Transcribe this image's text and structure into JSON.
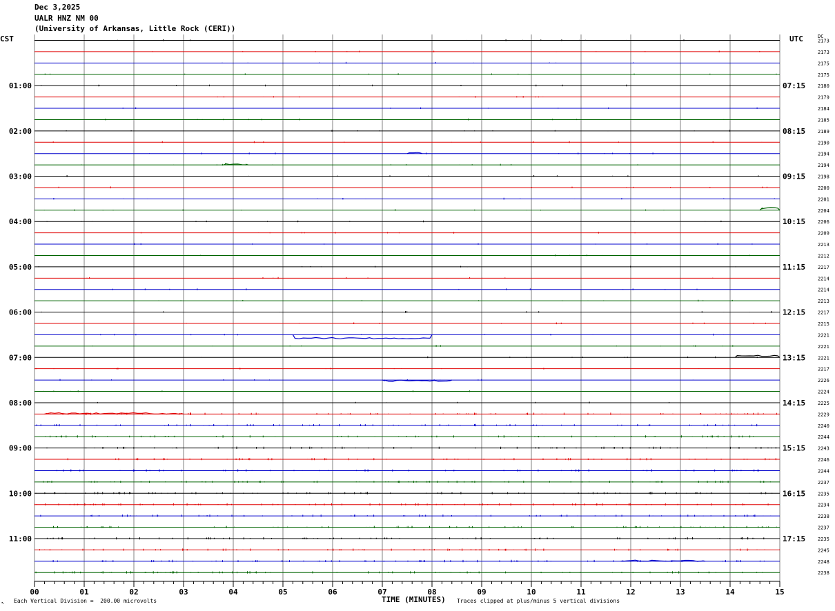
{
  "header": {
    "date": "Dec 3,2025",
    "station": "UALR HNZ NM 00",
    "network": "(University of Arkansas, Little Rock (CERI))"
  },
  "labels": {
    "left_zone": "CST",
    "right_zone": "UTC",
    "dc_label": "DC"
  },
  "footer": {
    "marker": "↖",
    "vertical_division": "Each Vertical Division =  200.00 microvolts",
    "xlabel": "TIME (MINUTES)",
    "clip_note": "Traces clipped at plus/minus 5 vertical divisions"
  },
  "colors": {
    "trace_cycle": [
      "#000000",
      "#e00000",
      "#0000cc",
      "#006400"
    ],
    "grid": "#808080"
  },
  "chart_data": {
    "type": "line",
    "title": "",
    "xlabel": "TIME (MINUTES)",
    "xlim": [
      0,
      15
    ],
    "x_ticks": [
      "00",
      "01",
      "02",
      "03",
      "04",
      "05",
      "06",
      "07",
      "08",
      "09",
      "10",
      "11",
      "12",
      "13",
      "14",
      "15"
    ],
    "rows_per_hour": 4,
    "minutes_per_row": 15,
    "cst_hour_labels": [
      "01:00",
      "02:00",
      "03:00",
      "04:00",
      "05:00",
      "06:00",
      "07:00",
      "08:00",
      "09:00",
      "10:00",
      "11:00"
    ],
    "utc_hour_labels": [
      "07:15",
      "08:15",
      "09:15",
      "10:15",
      "11:15",
      "12:15",
      "13:15",
      "14:15",
      "15:15",
      "16:15",
      "17:15"
    ],
    "dc_offsets": [
      2173,
      2173,
      2175,
      2175,
      2180,
      2179,
      2184,
      2185,
      2189,
      2190,
      2194,
      2194,
      2198,
      2200,
      2201,
      2204,
      2206,
      2209,
      2213,
      2212,
      2217,
      2214,
      2214,
      2213,
      2217,
      2215,
      2221,
      2221,
      2221,
      2217,
      2226,
      2224,
      2225,
      2229,
      2240,
      2244,
      2243,
      2246,
      2244,
      2237,
      2235,
      2234,
      2238,
      2237,
      2235,
      2245,
      2248,
      2238
    ],
    "grid": true,
    "events": [
      {
        "row": 26,
        "x_start": 5.2,
        "x_end": 8.0,
        "level": -2.5,
        "note": "offset episode"
      },
      {
        "row": 10,
        "x_start": 7.5,
        "x_end": 7.8,
        "level": 0.5
      },
      {
        "row": 11,
        "x_start": 3.8,
        "x_end": 4.3,
        "level": 0.4
      },
      {
        "row": 15,
        "x_start": 14.6,
        "x_end": 15.0,
        "level": 1.5
      },
      {
        "row": 28,
        "x_start": 14.1,
        "x_end": 15.0,
        "level": 1.2
      },
      {
        "row": 30,
        "x_start": 7.0,
        "x_end": 8.4,
        "level": -0.5
      },
      {
        "row": 33,
        "x_start": 0.2,
        "x_end": 3.0,
        "level": 0.4
      },
      {
        "row": 46,
        "x_start": 11.8,
        "x_end": 13.5,
        "level": 0.3
      }
    ]
  }
}
